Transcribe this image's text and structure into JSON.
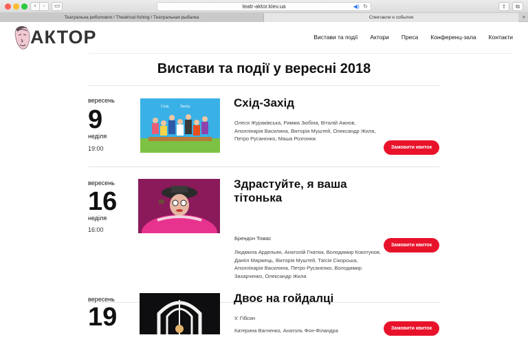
{
  "browser": {
    "url": "teatr-aktor.kiev.ua",
    "tabs": [
      {
        "label": "Театральна риболовля / Theatrical fishing / Театральная рыбалка"
      },
      {
        "label": "Спектакли и события"
      }
    ],
    "nav_back_glyph": "‹",
    "nav_fwd_glyph": "›",
    "sidebar_glyph": "▭",
    "audio_glyph": "◀)",
    "reload_glyph": "↻",
    "share_glyph": "⇧",
    "tabs_glyph": "⧉",
    "add_tab_glyph": "+"
  },
  "site": {
    "logo_text": "АКТОР",
    "nav": [
      "Вистави та події",
      "Актори",
      "Преса",
      "Конференц-зала",
      "Контакти"
    ],
    "page_title": "Вистави та події у вересні 2018"
  },
  "events": [
    {
      "month": "вересень",
      "day": "9",
      "weekday": "неділя",
      "time": "19:00",
      "title": "Схід-Захід",
      "author": "",
      "cast": "Олеся Жураківська, Римма Зюбіна, Віталій Ажнов, Аполлінарія Василина, Вікторія Муштей, Олександр Жила, Петро Русанєнко, Маша Розгонюк",
      "ticket_label": "Замовити квиток"
    },
    {
      "month": "вересень",
      "day": "16",
      "weekday": "неділя",
      "time": "16:00",
      "title": "Здрастуйте, я ваша тітонька",
      "author": "Брендон Томас",
      "cast": "Людмила Ардельян, Анатолій Гнатюк, Володимир Кокотунов, Даніїл Маржець, Вікторія Муштей, Таїсія Сікорська, Аполлінарія Василина, Петро Русанєнко, Володимир Захарченко, Олександр Жила",
      "ticket_label": "Замовити квиток"
    },
    {
      "month": "вересень",
      "day": "19",
      "weekday": "",
      "time": "",
      "title": "Двоє на гойдалці",
      "author": "У. Гібсон",
      "cast": "Катерина Вагненко, Анатоль Фон-Філандра",
      "ticket_label": "Замовити квиток"
    }
  ],
  "colors": {
    "ticket_button": "#e8132b",
    "poster1_bg": "#39b1e6",
    "poster2_bg": "#8a1a5a",
    "poster3_bg": "#0e0e10"
  }
}
